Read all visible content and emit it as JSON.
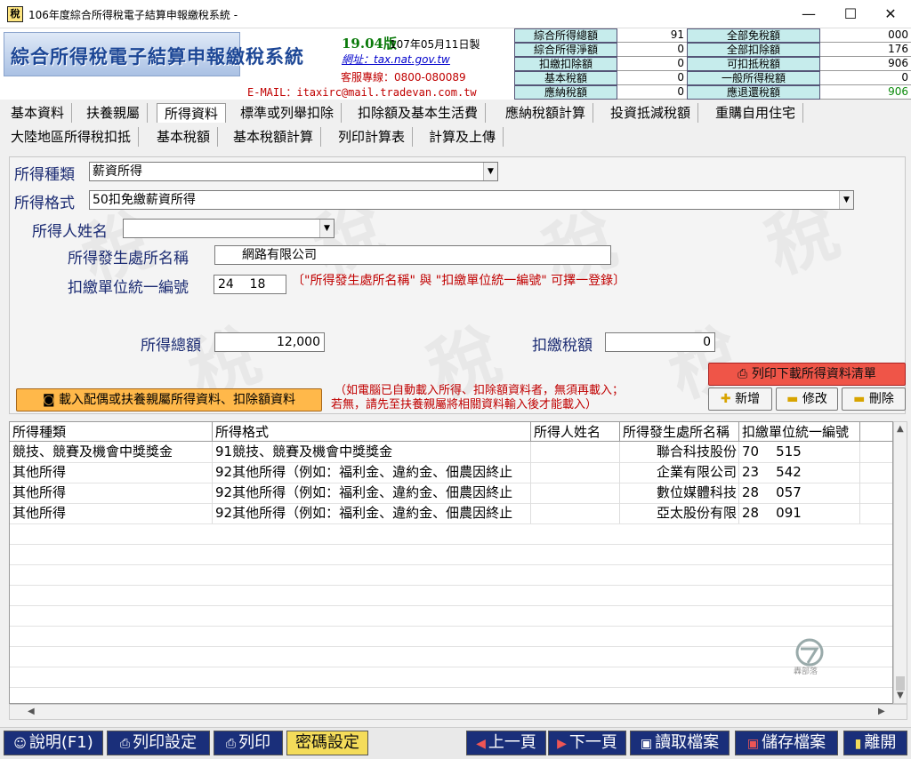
{
  "window": {
    "title": "106年度綜合所得稅電子結算申報繳稅系統 -",
    "icon_char": "稅",
    "minimize": "—",
    "maximize": "☐",
    "close": "✕"
  },
  "header": {
    "logo": "綜合所得稅電子結算申報繳稅系統",
    "version": "19.04版",
    "version_date": "107年05月11日製",
    "site_label": "網址：tax.nat.gov.tw",
    "hotline": "客服專線：0800-080089",
    "email": "E-MAIL：itaxirc@mail.tradevan.com.tw"
  },
  "summary": {
    "left": [
      {
        "label": "綜合所得總額",
        "value": "91"
      },
      {
        "label": "綜合所得淨額",
        "value": "0"
      },
      {
        "label": "扣繳扣除額",
        "value": "0"
      },
      {
        "label": "基本稅額",
        "value": "0"
      },
      {
        "label": "應納稅額",
        "value": "0"
      }
    ],
    "right": [
      {
        "label": "全部免稅額",
        "value": "000"
      },
      {
        "label": "全部扣除額",
        "value": "176"
      },
      {
        "label": "可扣抵稅額",
        "value": "906"
      },
      {
        "label": "一般所得稅額",
        "value": "0"
      },
      {
        "label": "應退還稅額",
        "value": "906"
      }
    ]
  },
  "tabs_row1": [
    "基本資料",
    "扶養親屬",
    "所得資料",
    "標準或列舉扣除",
    "扣除額及基本生活費",
    "應納稅額計算",
    "投資抵減稅額",
    "重購自用住宅"
  ],
  "tabs_row2": [
    "大陸地區所得稅扣抵",
    "基本稅額",
    "基本稅額計算",
    "列印計算表",
    "計算及上傳"
  ],
  "active_tab": "所得資料",
  "form": {
    "income_type_label": "所得種類",
    "income_type_value": "薪資所得",
    "income_format_label": "所得格式",
    "income_format_value": "50扣免繳薪資所得",
    "earner_name_label": "所得人姓名",
    "earner_name_value": "",
    "payer_name_label": "所得發生處所名稱",
    "payer_name_value": "網路有限公司",
    "payer_id_label": "扣繳單位統一編號",
    "payer_id_value": "24    18",
    "payer_note": "〔\"所得發生處所名稱\" 與 \"扣繳單位統一編號\" 可擇一登錄〕",
    "total_income_label": "所得總額",
    "total_income_value": "12,000",
    "withholding_label": "扣繳稅額",
    "withholding_value": "0",
    "load_button": "載入配偶或扶養親屬所得資料、扣除額資料",
    "load_note_line1": "（如電腦已自動載入所得、扣除額資料者，無須再載入；",
    "load_note_line2": "若無，請先至扶養親屬將相關資料輸入後才能載入）",
    "print_list_button": "列印下載所得資料清單",
    "add_button": "新增",
    "edit_button": "修改",
    "delete_button": "刪除"
  },
  "table": {
    "headers": [
      "所得種類",
      "所得格式",
      "所得人姓名",
      "所得發生處所名稱",
      "扣繳單位統一編號"
    ],
    "rows": [
      [
        "競技、競賽及機會中獎獎金",
        "91競技、競賽及機會中獎獎金",
        "",
        "聯合科技股份",
        "70    515"
      ],
      [
        "其他所得",
        "92其他所得（例如：福利金、違約金、佃農因終止",
        "",
        "企業有限公司",
        "23    542"
      ],
      [
        "其他所得",
        "92其他所得（例如：福利金、違約金、佃農因終止",
        "",
        "數位媒體科技",
        "28    057"
      ],
      [
        "其他所得",
        "92其他所得（例如：福利金、違約金、佃農因終止",
        "",
        "亞太股份有限",
        "28    091"
      ]
    ],
    "corner_logo_text": "轟部落"
  },
  "bottom_buttons": [
    {
      "label": "說明(F1)",
      "icon": "☺"
    },
    {
      "label": "列印設定",
      "icon": "⎙"
    },
    {
      "label": "列印",
      "icon": "⎙"
    },
    {
      "label": "密碼設定",
      "icon": ""
    },
    {
      "label": "上一頁",
      "icon": "◀"
    },
    {
      "label": "下一頁",
      "icon": "▶"
    },
    {
      "label": "讀取檔案",
      "icon": "▣"
    },
    {
      "label": "儲存檔案",
      "icon": "▣"
    },
    {
      "label": "離開",
      "icon": "▮"
    }
  ],
  "colors": {
    "nav_button_bg": "#1a2f7a",
    "highlight_button_bg": "#f4dc5a",
    "load_button_bg": "#ffb84a",
    "print_button_bg": "#ef5548"
  }
}
